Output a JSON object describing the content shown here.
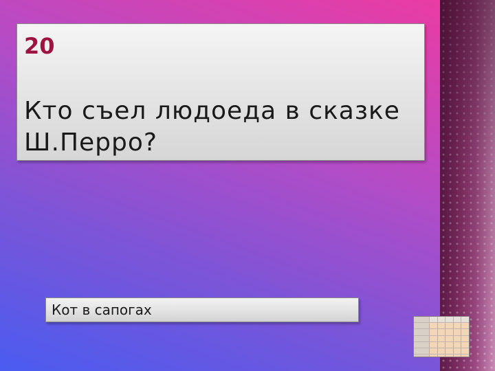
{
  "slide": {
    "points": "20",
    "question_lines": [
      "Кто съел людоеда в сказке",
      "Ш.Перро?"
    ],
    "answer": "Кот в сапогах"
  },
  "thumbnail": {
    "icon": "game-board-thumbnail-icon"
  }
}
